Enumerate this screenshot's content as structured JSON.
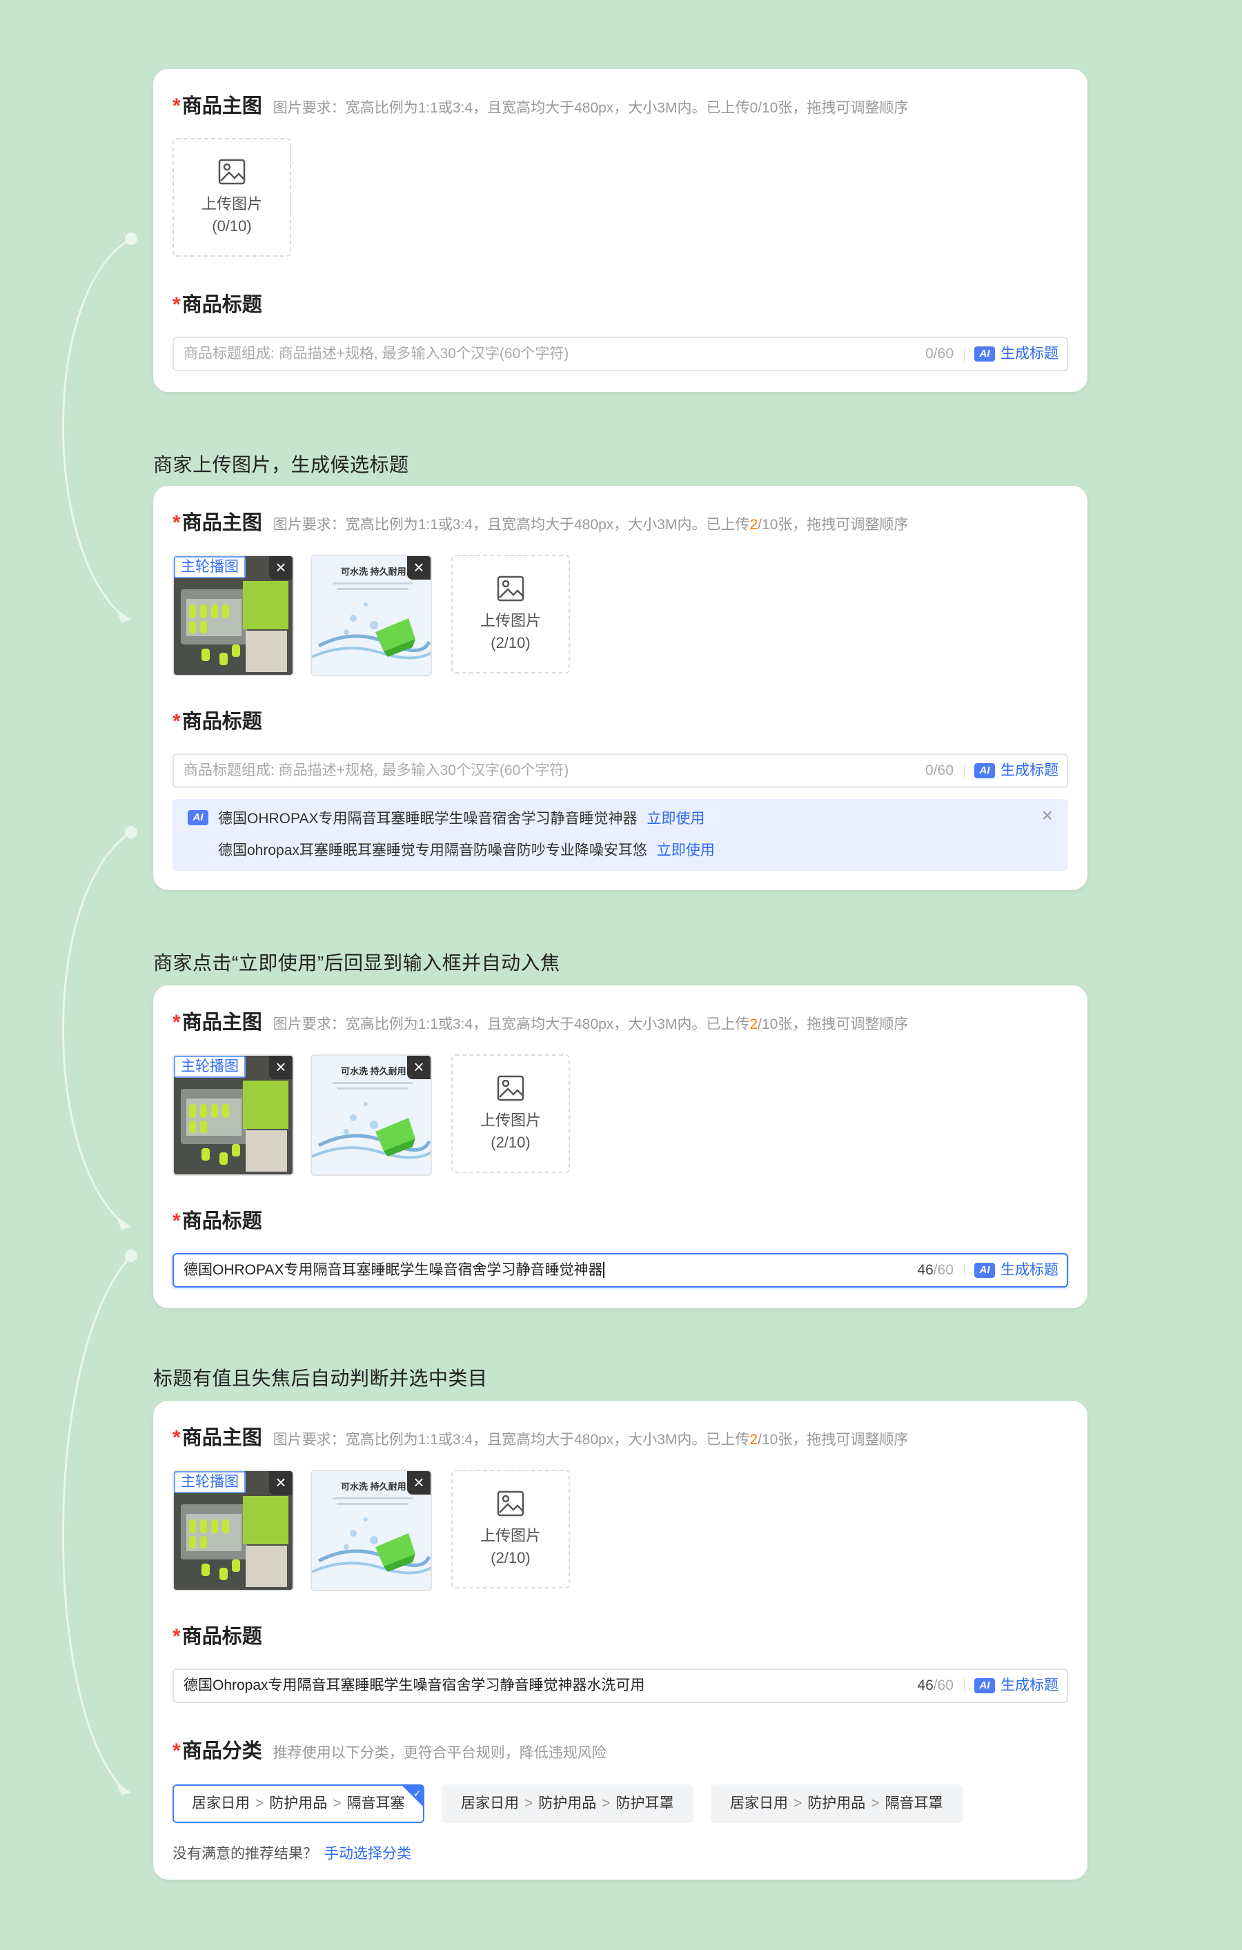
{
  "main_image": {
    "title": "商品主图",
    "hint": "图片要求：宽高比例为1:1或3:4，且宽高均大于480px，大小3M内。已上传0/10张，拖拽可调整顺序",
    "hint_prefix": "图片要求：宽高比例为1:1或3:4，且宽高均大于480px，大小3M内。已上传",
    "hint_count": "2",
    "hint_suffix": "/10张，拖拽可调整顺序",
    "upload_label": "上传图片",
    "upload_count_empty": "(0/10)",
    "upload_count": "(2/10)",
    "main_badge": "主轮播图",
    "thumb2_text": "可水洗 持久耐用"
  },
  "title_field": {
    "title": "商品标题",
    "placeholder": "商品标题组成: 商品描述+规格, 最多输入30个汉字(60个字符)",
    "count_empty": "0/60",
    "count_value": "46",
    "count_max": "/60",
    "ai_tag": "AI",
    "generate_label": "生成标题",
    "value_step3": "德国OHROPAX专用隔音耳塞睡眠学生噪音宿舍学习静音睡觉神器",
    "value_step4": "德国Ohropax专用隔音耳塞睡眠学生噪音宿舍学习静音睡觉神器水洗可用"
  },
  "suggestions": {
    "items": [
      "德国OHROPAX专用隔音耳塞睡眠学生噪音宿舍学习静音睡觉神器",
      "德国ohropax耳塞睡眠耳塞睡觉专用隔音防噪音防吵专业降噪安耳悠"
    ],
    "use_label": "立即使用",
    "close": "×"
  },
  "category": {
    "title": "商品分类",
    "hint": "推荐使用以下分类，更符合平台规则，降低违规风险",
    "options": [
      [
        "居家日用",
        "防护用品",
        "隔音耳塞"
      ],
      [
        "居家日用",
        "防护用品",
        "防护耳罩"
      ],
      [
        "居家日用",
        "防护用品",
        "隔音耳罩"
      ]
    ],
    "sep": ">",
    "not_satisfied": "没有满意的推荐结果？",
    "manual_link": "手动选择分类"
  },
  "captions": {
    "step2": "商家上传图片，生成候选标题",
    "step3": "商家点击“立即使用”后回显到输入框并自动入焦",
    "step4": "标题有值且失焦后自动判断并选中类目"
  },
  "colors": {
    "background": "#c7e4cc",
    "accent": "#2e6bf0",
    "required": "#f5362e",
    "count_highlight": "#ff7a00"
  }
}
